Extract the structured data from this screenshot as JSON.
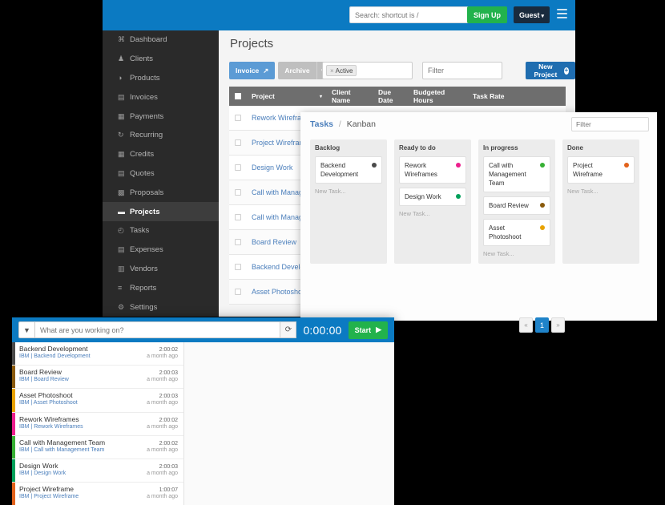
{
  "topbar": {
    "search_placeholder": "Search: shortcut is /",
    "signup_label": "Sign Up",
    "guest_label": "Guest",
    "guest_caret": "▾",
    "menu_icon": "hamburger-icon"
  },
  "sidebar": {
    "items": [
      {
        "label": "Dashboard",
        "icon": "⌘",
        "active": false
      },
      {
        "label": "Clients",
        "icon": "♟",
        "active": false
      },
      {
        "label": "Products",
        "icon": "◑",
        "active": false
      },
      {
        "label": "Invoices",
        "icon": "▤",
        "active": false
      },
      {
        "label": "Payments",
        "icon": "▦",
        "active": false
      },
      {
        "label": "Recurring",
        "icon": "↻",
        "active": false
      },
      {
        "label": "Credits",
        "icon": "▦",
        "active": false
      },
      {
        "label": "Quotes",
        "icon": "▤",
        "active": false
      },
      {
        "label": "Proposals",
        "icon": "▩",
        "active": false
      },
      {
        "label": "Projects",
        "icon": "▬",
        "active": true
      },
      {
        "label": "Tasks",
        "icon": "◴",
        "active": false
      },
      {
        "label": "Expenses",
        "icon": "▤",
        "active": false
      },
      {
        "label": "Vendors",
        "icon": "▥",
        "active": false
      },
      {
        "label": "Reports",
        "icon": "≡",
        "active": false
      },
      {
        "label": "Settings",
        "icon": "⚙",
        "active": false
      }
    ]
  },
  "projects_page": {
    "title": "Projects",
    "toolbar": {
      "invoice_label": "Invoice",
      "invoice_icon": "↗",
      "archive_label": "Archive",
      "archive_caret": "▾",
      "tag_value": "Active",
      "tag_remove": "×",
      "filter_placeholder": "Filter",
      "new_project_label": "New Project",
      "new_project_icon": "+"
    },
    "table": {
      "columns": [
        "Project",
        "Client Name",
        "Due Date",
        "Budgeted Hours",
        "Task Rate"
      ],
      "sort_caret": "▾",
      "rows": [
        {
          "name": "Rework Wireframes"
        },
        {
          "name": "Project Wireframe"
        },
        {
          "name": "Design Work"
        },
        {
          "name": "Call with Management"
        },
        {
          "name": "Call with Management"
        },
        {
          "name": "Board Review"
        },
        {
          "name": "Backend Development"
        },
        {
          "name": "Asset Photoshoot"
        }
      ]
    }
  },
  "kanban": {
    "breadcrumb_link": "Tasks",
    "breadcrumb_sep": "/",
    "breadcrumb_current": "Kanban",
    "filter_placeholder": "Filter",
    "new_task_label": "New Task...",
    "columns": [
      {
        "title": "Backlog",
        "cards": [
          {
            "label": "Backend Development",
            "color": "#4a4a4a"
          }
        ]
      },
      {
        "title": "Ready to do",
        "cards": [
          {
            "label": "Rework Wireframes",
            "color": "#ec1f8d"
          },
          {
            "label": "Design Work",
            "color": "#00a05a"
          }
        ]
      },
      {
        "title": "In progress",
        "cards": [
          {
            "label": "Call with Management Team",
            "color": "#37b034"
          },
          {
            "label": "Board Review",
            "color": "#8a5a0c"
          },
          {
            "label": "Asset Photoshoot",
            "color": "#e8a200"
          }
        ]
      },
      {
        "title": "Done",
        "cards": [
          {
            "label": "Project Wireframe",
            "color": "#e2621b"
          }
        ]
      }
    ]
  },
  "timer": {
    "funnel_icon": "▼",
    "input_placeholder": "What are you working on?",
    "refresh_icon": "⟳",
    "clock": "0:00:00",
    "start_label": "Start",
    "start_icon": "▶",
    "entries": [
      {
        "title": "Backend Development",
        "duration": "2:00:02",
        "client": "IBM",
        "project": "Backend Development",
        "ago": "a month ago",
        "color": "#4a4a4a"
      },
      {
        "title": "Board Review",
        "duration": "2:00:03",
        "client": "IBM",
        "project": "Board Review",
        "ago": "a month ago",
        "color": "#8a5a0c"
      },
      {
        "title": "Asset Photoshoot",
        "duration": "2:00:03",
        "client": "IBM",
        "project": "Asset Photoshoot",
        "ago": "a month ago",
        "color": "#e8a200"
      },
      {
        "title": "Rework Wireframes",
        "duration": "2:00:02",
        "client": "IBM",
        "project": "Rework Wireframes",
        "ago": "a month ago",
        "color": "#ec1f8d"
      },
      {
        "title": "Call with Management Team",
        "duration": "2:00:02",
        "client": "IBM",
        "project": "Call with Management Team",
        "ago": "a month ago",
        "color": "#37b034"
      },
      {
        "title": "Design Work",
        "duration": "2:00:03",
        "client": "IBM",
        "project": "Design Work",
        "ago": "a month ago",
        "color": "#00a05a"
      },
      {
        "title": "Project Wireframe",
        "duration": "1:00:07",
        "client": "IBM",
        "project": "Project Wireframe",
        "ago": "a month ago",
        "color": "#e2621b"
      }
    ],
    "meta_sep": "|"
  },
  "pagination": {
    "prev": "«",
    "current": "1",
    "next": "»"
  },
  "colors": {
    "brand_blue": "#0b7ac2",
    "green": "#22b24c",
    "dark_navy": "#192b3d",
    "sidebar": "#2a2a2a",
    "table_header": "#6e6e6e",
    "link_blue": "#4a7ebb"
  }
}
